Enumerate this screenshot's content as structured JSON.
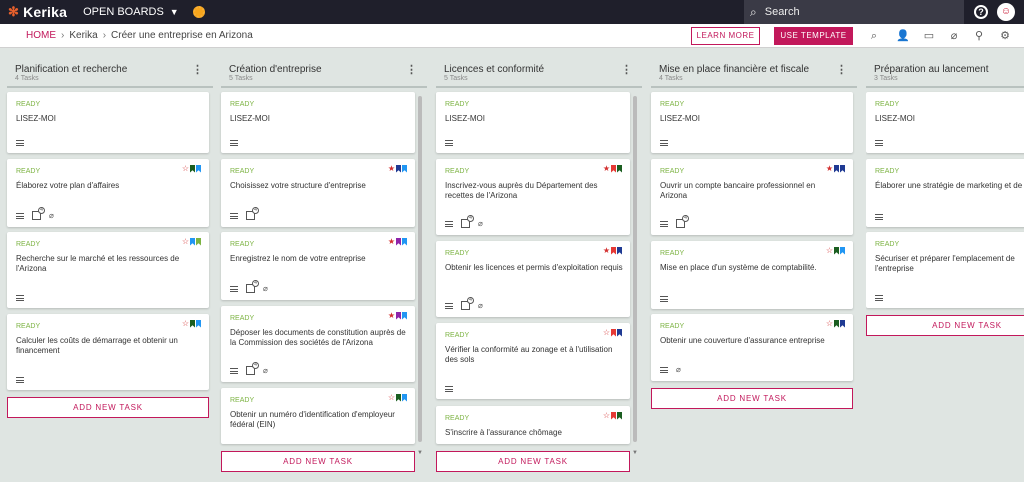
{
  "app": {
    "logo": "Kerika",
    "boards_label": "OPEN BOARDS",
    "search_placeholder": "Search",
    "avatar": "☺"
  },
  "breadcrumb": {
    "home": "HOME",
    "org": "Kerika",
    "board": "Créer une entreprise en Arizona"
  },
  "toolbar": {
    "learn_more": "LEARN MORE",
    "use_template": "USE TEMPLATE"
  },
  "colors": {
    "accent": "#c2185b",
    "status": "#7cb342",
    "star": "#d32f2f",
    "navy": "#1f3a93",
    "blue": "#2196f3",
    "green": "#1b5e20",
    "purple": "#8e24aa",
    "red": "#e53935"
  },
  "columns": [
    {
      "title": "Planification et recherche",
      "count": "4 Tasks",
      "add": "ADD NEW TASK",
      "cards": [
        {
          "status": "READY",
          "title": "LISEZ-MOI"
        },
        {
          "status": "READY",
          "title": "Élaborez votre plan d'affaires",
          "checklist": "4"
        },
        {
          "status": "READY",
          "title": "Recherche sur le marché et les ressources de l'Arizona"
        },
        {
          "status": "READY",
          "title": "Calculer les coûts de démarrage et obtenir un financement"
        }
      ]
    },
    {
      "title": "Création d'entreprise",
      "count": "5 Tasks",
      "add": "ADD NEW TASK",
      "cards": [
        {
          "status": "READY",
          "title": "LISEZ-MOI"
        },
        {
          "status": "READY",
          "title": "Choisissez votre structure d'entreprise",
          "checklist": "4"
        },
        {
          "status": "READY",
          "title": "Enregistrez le nom de votre entreprise",
          "checklist": "4"
        },
        {
          "status": "READY",
          "title": "Déposer les documents de constitution auprès de la Commission des sociétés de l'Arizona",
          "checklist": "4"
        },
        {
          "status": "READY",
          "title": "Obtenir un numéro d'identification d'employeur fédéral (EIN)"
        }
      ]
    },
    {
      "title": "Licences et conformité",
      "count": "5 Tasks",
      "add": "ADD NEW TASK",
      "cards": [
        {
          "status": "READY",
          "title": "LISEZ-MOI"
        },
        {
          "status": "READY",
          "title": "Inscrivez-vous auprès du Département des recettes de l'Arizona",
          "checklist": "4"
        },
        {
          "status": "READY",
          "title": "Obtenir les licences et permis d'exploitation requis",
          "checklist": "4"
        },
        {
          "status": "READY",
          "title": "Vérifier la conformité au zonage et à l'utilisation des sols"
        },
        {
          "status": "READY",
          "title": "S'inscrire à l'assurance chômage"
        }
      ]
    },
    {
      "title": "Mise en place financière et fiscale",
      "count": "4 Tasks",
      "add": "ADD NEW TASK",
      "cards": [
        {
          "status": "READY",
          "title": "LISEZ-MOI"
        },
        {
          "status": "READY",
          "title": "Ouvrir un compte bancaire professionnel en Arizona",
          "checklist": "4"
        },
        {
          "status": "READY",
          "title": "Mise en place d'un système de comptabilité."
        },
        {
          "status": "READY",
          "title": "Obtenir une couverture d'assurance entreprise"
        }
      ]
    },
    {
      "title": "Préparation au lancement",
      "count": "3 Tasks",
      "add": "ADD NEW TASK",
      "cards": [
        {
          "status": "READY",
          "title": "LISEZ-MOI"
        },
        {
          "status": "READY",
          "title": "Élaborer une stratégie de marketing et de"
        },
        {
          "status": "READY",
          "title": "Sécuriser et préparer l'emplacement de l'entreprise"
        }
      ]
    }
  ]
}
